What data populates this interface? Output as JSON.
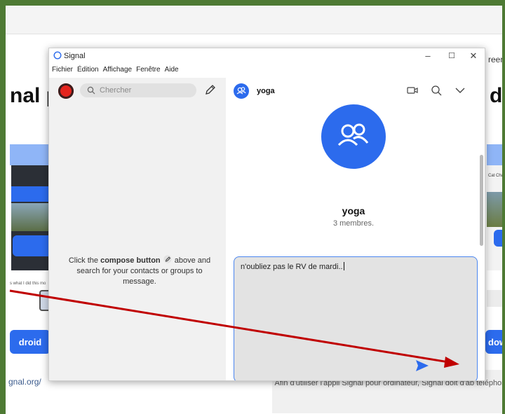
{
  "background_page": {
    "nav_text": "reers",
    "heading_left": "nal p",
    "heading_right": "di",
    "phone_left_label": "Cat Chat",
    "small_caption": "s what I did this mo",
    "android_button": "droid",
    "windows_button": "dows",
    "link_text": "gnal.org/",
    "info_text": "Afin d'utiliser l'appli Signal pour ordinateur, Signal doit d'ab téléphone."
  },
  "window": {
    "title": "Signal",
    "controls": {
      "minimize": "–",
      "maximize": "☐",
      "close": "✕"
    },
    "menu": [
      "Fichier",
      "Édition",
      "Affichage",
      "Fenêtre",
      "Aide"
    ]
  },
  "sidebar": {
    "search_placeholder": "Chercher",
    "hint_part1": "Click the ",
    "hint_bold": "compose button",
    "hint_part2": " above and search for your contacts or groups to message."
  },
  "conversation": {
    "name": "yoga",
    "members": "3 membres.",
    "draft": "n'oubliez pas le RV de mardi.."
  },
  "colors": {
    "accent": "#2c6bed",
    "frame": "#4e7a34",
    "arrow": "#c00000"
  }
}
